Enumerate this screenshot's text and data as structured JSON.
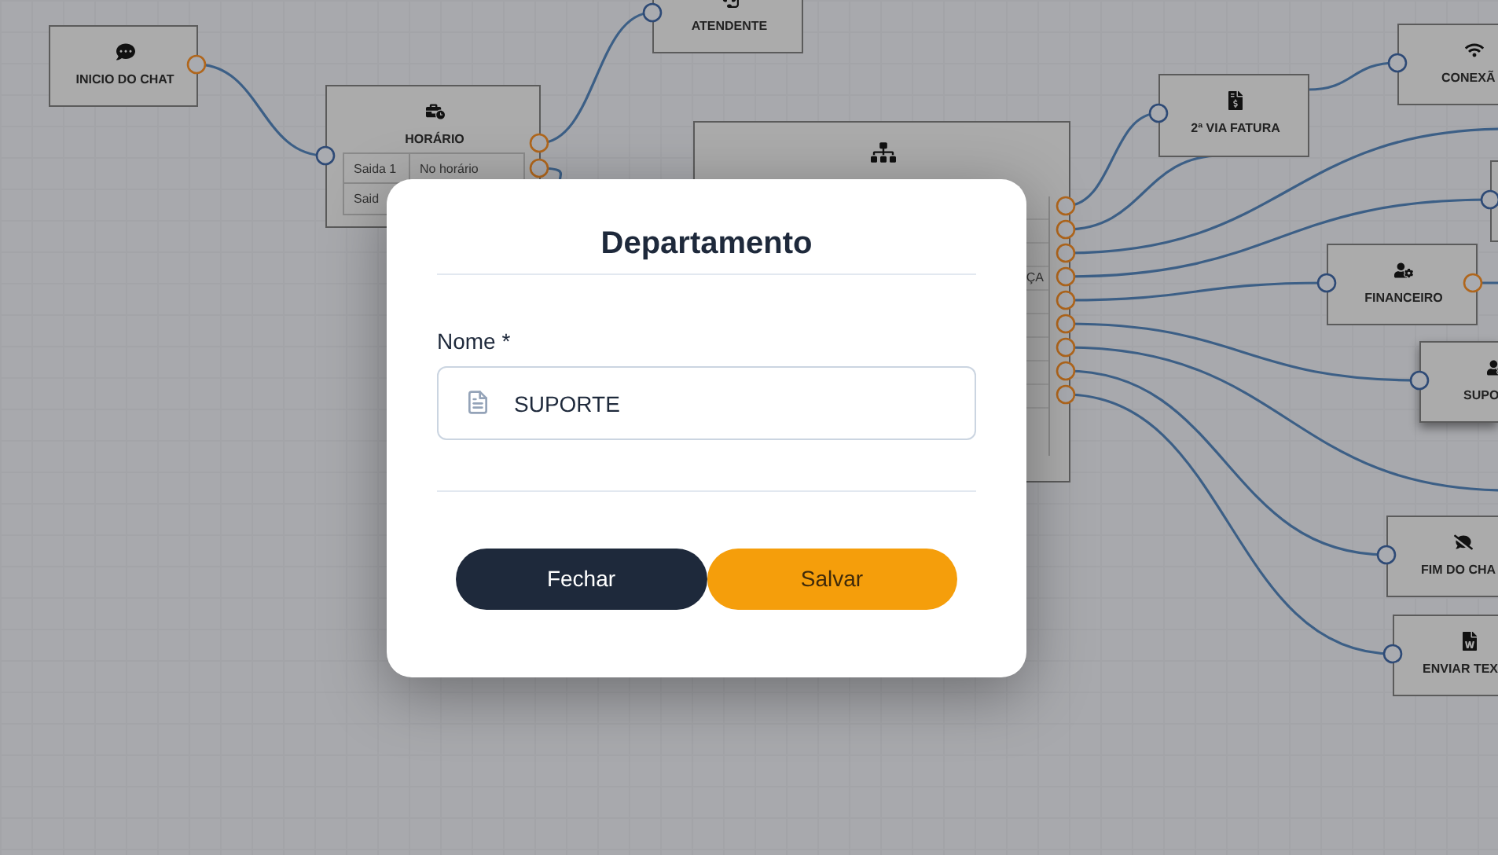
{
  "canvas": {
    "nodes": [
      {
        "label": "INICIO DO CHAT",
        "selected": false
      },
      {
        "label": "HORÁRIO",
        "selected": false,
        "rows": [
          {
            "cells": [
              "Saida 1",
              "No horário"
            ]
          },
          {
            "cells": [
              "Said"
            ]
          }
        ]
      },
      {
        "label": "ATENDENTE",
        "selected": false
      },
      {
        "selected": false,
        "table_text": "ÇA"
      },
      {
        "label": "2ª VIA FATURA",
        "selected": false
      },
      {
        "label": "CONEXÃ",
        "selected": false
      },
      {
        "selected": false
      },
      {
        "label": "FINANCEIRO",
        "selected": false
      },
      {
        "label": "SUPO",
        "selected": true
      },
      {
        "label": "FIM DO CHA",
        "selected": false
      },
      {
        "label": "ENVIAR TEX",
        "selected": false
      }
    ]
  },
  "modal": {
    "title": "Departamento",
    "field": {
      "label": "Nome *",
      "value": "SUPORTE"
    },
    "buttons": [
      {
        "label": "Fechar",
        "kind": "secondary"
      },
      {
        "label": "Salvar",
        "kind": "primary"
      }
    ]
  }
}
